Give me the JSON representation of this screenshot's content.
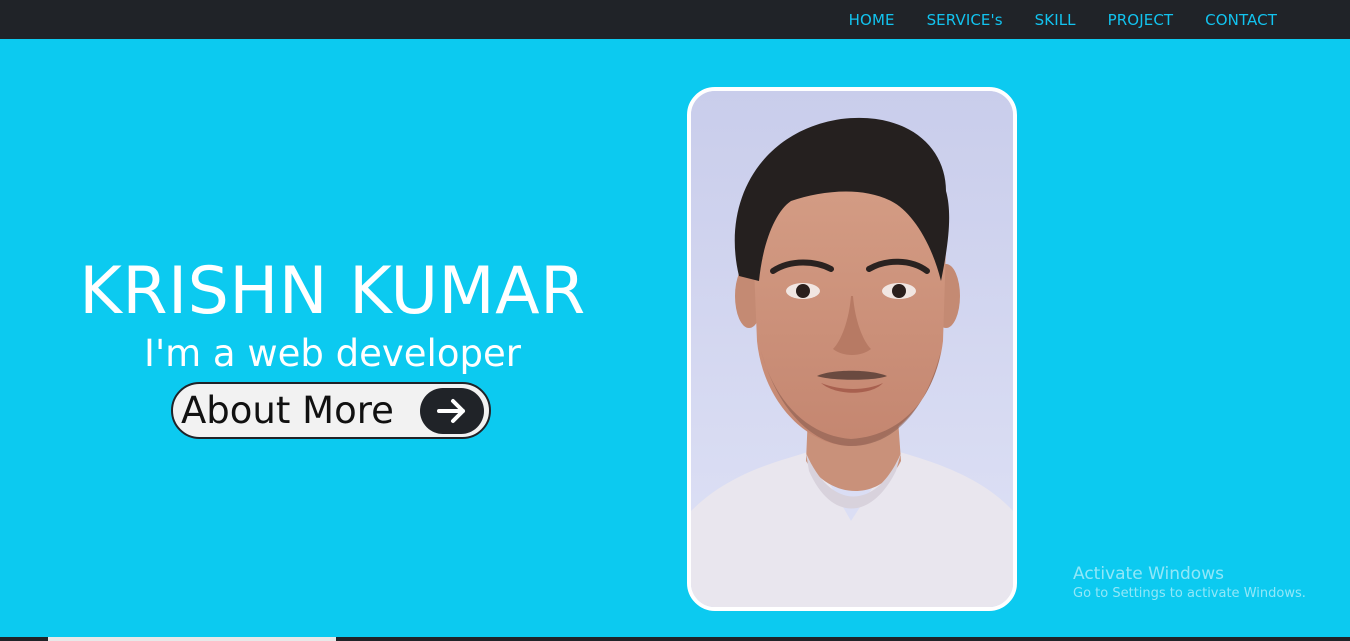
{
  "nav": {
    "items": [
      {
        "label": "HOME"
      },
      {
        "label": "SERVICE's"
      },
      {
        "label": "SKILL"
      },
      {
        "label": "PROJECT"
      },
      {
        "label": "CONTACT"
      }
    ]
  },
  "hero": {
    "name": "KRISHN KUMAR",
    "tagline": "I'm a web developer",
    "button_label": "About More",
    "button_icon": "arrow-right-icon",
    "photo": "profile-photo"
  },
  "watermark": {
    "title": "Activate Windows",
    "subtitle": "Go to Settings to activate Windows."
  },
  "colors": {
    "navbar_bg": "#202328",
    "nav_link": "#12c3ef",
    "hero_bg": "#0ccaf0",
    "text": "#ffffff",
    "button_bg": "#f2f2f2",
    "button_icon_bg": "#202328"
  }
}
